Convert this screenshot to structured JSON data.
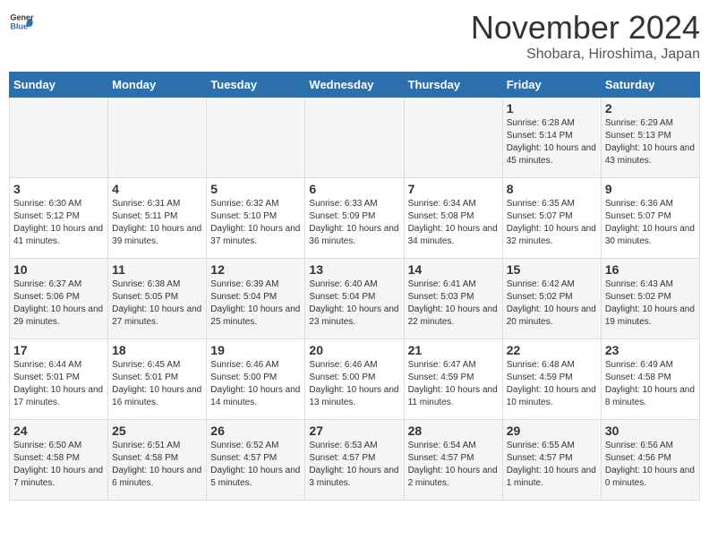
{
  "logo": {
    "text_general": "General",
    "text_blue": "Blue"
  },
  "title": {
    "month": "November 2024",
    "location": "Shobara, Hiroshima, Japan"
  },
  "days_of_week": [
    "Sunday",
    "Monday",
    "Tuesday",
    "Wednesday",
    "Thursday",
    "Friday",
    "Saturday"
  ],
  "weeks": [
    [
      {
        "day": "",
        "info": ""
      },
      {
        "day": "",
        "info": ""
      },
      {
        "day": "",
        "info": ""
      },
      {
        "day": "",
        "info": ""
      },
      {
        "day": "",
        "info": ""
      },
      {
        "day": "1",
        "info": "Sunrise: 6:28 AM\nSunset: 5:14 PM\nDaylight: 10 hours and 45 minutes."
      },
      {
        "day": "2",
        "info": "Sunrise: 6:29 AM\nSunset: 5:13 PM\nDaylight: 10 hours and 43 minutes."
      }
    ],
    [
      {
        "day": "3",
        "info": "Sunrise: 6:30 AM\nSunset: 5:12 PM\nDaylight: 10 hours and 41 minutes."
      },
      {
        "day": "4",
        "info": "Sunrise: 6:31 AM\nSunset: 5:11 PM\nDaylight: 10 hours and 39 minutes."
      },
      {
        "day": "5",
        "info": "Sunrise: 6:32 AM\nSunset: 5:10 PM\nDaylight: 10 hours and 37 minutes."
      },
      {
        "day": "6",
        "info": "Sunrise: 6:33 AM\nSunset: 5:09 PM\nDaylight: 10 hours and 36 minutes."
      },
      {
        "day": "7",
        "info": "Sunrise: 6:34 AM\nSunset: 5:08 PM\nDaylight: 10 hours and 34 minutes."
      },
      {
        "day": "8",
        "info": "Sunrise: 6:35 AM\nSunset: 5:07 PM\nDaylight: 10 hours and 32 minutes."
      },
      {
        "day": "9",
        "info": "Sunrise: 6:36 AM\nSunset: 5:07 PM\nDaylight: 10 hours and 30 minutes."
      }
    ],
    [
      {
        "day": "10",
        "info": "Sunrise: 6:37 AM\nSunset: 5:06 PM\nDaylight: 10 hours and 29 minutes."
      },
      {
        "day": "11",
        "info": "Sunrise: 6:38 AM\nSunset: 5:05 PM\nDaylight: 10 hours and 27 minutes."
      },
      {
        "day": "12",
        "info": "Sunrise: 6:39 AM\nSunset: 5:04 PM\nDaylight: 10 hours and 25 minutes."
      },
      {
        "day": "13",
        "info": "Sunrise: 6:40 AM\nSunset: 5:04 PM\nDaylight: 10 hours and 23 minutes."
      },
      {
        "day": "14",
        "info": "Sunrise: 6:41 AM\nSunset: 5:03 PM\nDaylight: 10 hours and 22 minutes."
      },
      {
        "day": "15",
        "info": "Sunrise: 6:42 AM\nSunset: 5:02 PM\nDaylight: 10 hours and 20 minutes."
      },
      {
        "day": "16",
        "info": "Sunrise: 6:43 AM\nSunset: 5:02 PM\nDaylight: 10 hours and 19 minutes."
      }
    ],
    [
      {
        "day": "17",
        "info": "Sunrise: 6:44 AM\nSunset: 5:01 PM\nDaylight: 10 hours and 17 minutes."
      },
      {
        "day": "18",
        "info": "Sunrise: 6:45 AM\nSunset: 5:01 PM\nDaylight: 10 hours and 16 minutes."
      },
      {
        "day": "19",
        "info": "Sunrise: 6:46 AM\nSunset: 5:00 PM\nDaylight: 10 hours and 14 minutes."
      },
      {
        "day": "20",
        "info": "Sunrise: 6:46 AM\nSunset: 5:00 PM\nDaylight: 10 hours and 13 minutes."
      },
      {
        "day": "21",
        "info": "Sunrise: 6:47 AM\nSunset: 4:59 PM\nDaylight: 10 hours and 11 minutes."
      },
      {
        "day": "22",
        "info": "Sunrise: 6:48 AM\nSunset: 4:59 PM\nDaylight: 10 hours and 10 minutes."
      },
      {
        "day": "23",
        "info": "Sunrise: 6:49 AM\nSunset: 4:58 PM\nDaylight: 10 hours and 8 minutes."
      }
    ],
    [
      {
        "day": "24",
        "info": "Sunrise: 6:50 AM\nSunset: 4:58 PM\nDaylight: 10 hours and 7 minutes."
      },
      {
        "day": "25",
        "info": "Sunrise: 6:51 AM\nSunset: 4:58 PM\nDaylight: 10 hours and 6 minutes."
      },
      {
        "day": "26",
        "info": "Sunrise: 6:52 AM\nSunset: 4:57 PM\nDaylight: 10 hours and 5 minutes."
      },
      {
        "day": "27",
        "info": "Sunrise: 6:53 AM\nSunset: 4:57 PM\nDaylight: 10 hours and 3 minutes."
      },
      {
        "day": "28",
        "info": "Sunrise: 6:54 AM\nSunset: 4:57 PM\nDaylight: 10 hours and 2 minutes."
      },
      {
        "day": "29",
        "info": "Sunrise: 6:55 AM\nSunset: 4:57 PM\nDaylight: 10 hours and 1 minute."
      },
      {
        "day": "30",
        "info": "Sunrise: 6:56 AM\nSunset: 4:56 PM\nDaylight: 10 hours and 0 minutes."
      }
    ]
  ]
}
